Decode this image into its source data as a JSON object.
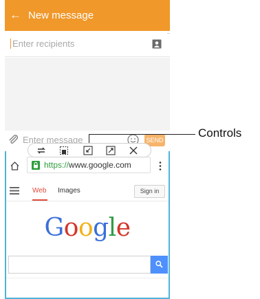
{
  "appbar": {
    "title": "New message",
    "color": "#f0982a"
  },
  "recipients": {
    "placeholder": "Enter recipients",
    "value": ""
  },
  "compose": {
    "placeholder": "Enter message",
    "value": "",
    "send_label": "SEND"
  },
  "controls": {
    "icons": [
      "switch-icon",
      "capture-icon",
      "minimize-icon",
      "maximize-icon",
      "close-icon"
    ]
  },
  "browser": {
    "url_scheme": "https://",
    "url_rest": "www.google.com",
    "nav": {
      "tab_web": "Web",
      "tab_images": "Images",
      "sign_in": "Sign in"
    },
    "logo": {
      "letters": [
        "G",
        "o",
        "o",
        "g",
        "l",
        "e"
      ],
      "colors": [
        "#3b6fd8",
        "#d2352a",
        "#f1b21a",
        "#3b6fd8",
        "#2f9b46",
        "#d2352a"
      ]
    },
    "search_value": "",
    "accent": "#4fb3d8"
  },
  "callout": {
    "label": "Controls"
  }
}
